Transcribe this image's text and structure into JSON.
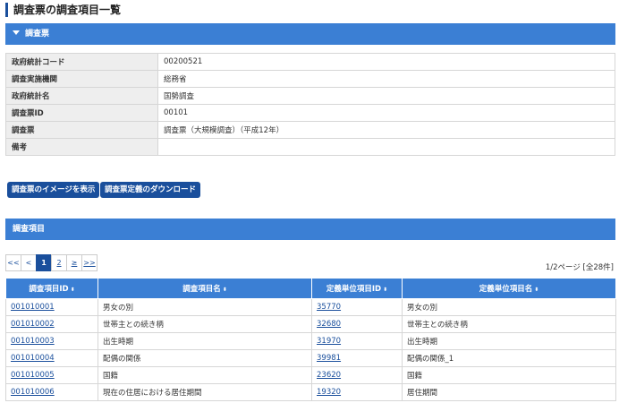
{
  "page_title": "調査票の調査項目一覧",
  "section_survey": {
    "title": "調査票"
  },
  "info_rows": [
    {
      "key": "政府統計コード",
      "value": "00200521"
    },
    {
      "key": "調査実施機関",
      "value": "総務省"
    },
    {
      "key": "政府統計名",
      "value": "国勢調査"
    },
    {
      "key": "調査票ID",
      "value": "00101"
    },
    {
      "key": "調査票",
      "value": "調査票（大規模調査）（平成12年）"
    },
    {
      "key": "備考",
      "value": ""
    }
  ],
  "buttons": {
    "show_image": "調査票のイメージを表示",
    "download_def": "調査票定義のダウンロード"
  },
  "section_items": {
    "title": "調査項目"
  },
  "pager": {
    "first": "<<",
    "prev": "<",
    "pages": [
      "1",
      "2"
    ],
    "next": "≥",
    "last": ">>",
    "info": "1/2ページ [全28件]"
  },
  "table": {
    "headers": [
      "調査項目ID",
      "調査項目名",
      "定義単位項目ID",
      "定義単位項目名"
    ],
    "sort_icon": "⬍",
    "rows": [
      [
        "001010001",
        "男女の別",
        "35770",
        "男女の別"
      ],
      [
        "001010002",
        "世帯主との続き柄",
        "32680",
        "世帯主との続き柄"
      ],
      [
        "001010003",
        "出生時期",
        "31970",
        "出生時期"
      ],
      [
        "001010004",
        "配偶の関係",
        "39981",
        "配偶の関係_1"
      ],
      [
        "001010005",
        "国籍",
        "23620",
        "国籍"
      ],
      [
        "001010006",
        "現在の住居における居住期間",
        "19320",
        "居住期間"
      ]
    ]
  }
}
